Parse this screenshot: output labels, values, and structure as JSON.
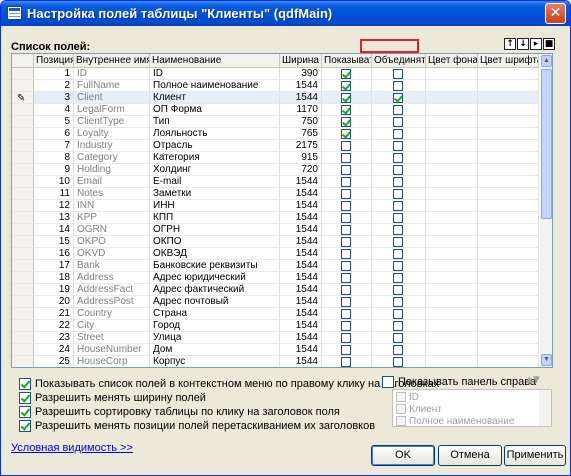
{
  "window": {
    "title": "Настройка полей таблицы \"Клиенты\" (qdfMain)",
    "close": "✕"
  },
  "section_label": "Список полей:",
  "toolbar": {
    "up": "↑",
    "down": "↓",
    "btn3": "▸",
    "btn4": "■"
  },
  "columns": [
    "Позиция",
    "Внутреннее имя",
    "Наименование",
    "Ширина",
    "Показывать",
    "Объединять",
    "Цвет фона",
    "Цвет шрифта"
  ],
  "rows": [
    {
      "pos": "1",
      "name": "ID",
      "title": "ID",
      "width": "390",
      "show": true,
      "merge": false
    },
    {
      "pos": "2",
      "name": "FullName",
      "title": "Полное наименование",
      "width": "1544",
      "show": true,
      "merge": false
    },
    {
      "pos": "3",
      "name": "Client",
      "title": "Клиент",
      "width": "1544",
      "show": true,
      "merge": true,
      "selected": true
    },
    {
      "pos": "4",
      "name": "LegalForm",
      "title": "ОП Форма",
      "width": "1170",
      "show": true,
      "merge": false
    },
    {
      "pos": "5",
      "name": "ClientType",
      "title": "Тип",
      "width": "750",
      "show": true,
      "merge": false
    },
    {
      "pos": "6",
      "name": "Loyalty",
      "title": "Лояльность",
      "width": "765",
      "show": true,
      "merge": false
    },
    {
      "pos": "7",
      "name": "Industry",
      "title": "Отрасль",
      "width": "2175",
      "show": false,
      "merge": false
    },
    {
      "pos": "8",
      "name": "Category",
      "title": "Категория",
      "width": "915",
      "show": false,
      "merge": false
    },
    {
      "pos": "9",
      "name": "Holding",
      "title": "Холдинг",
      "width": "720",
      "show": false,
      "merge": false
    },
    {
      "pos": "10",
      "name": "Email",
      "title": "E-mail",
      "width": "1544",
      "show": false,
      "merge": false
    },
    {
      "pos": "11",
      "name": "Notes",
      "title": "Заметки",
      "width": "1544",
      "show": false,
      "merge": false
    },
    {
      "pos": "12",
      "name": "INN",
      "title": "ИНН",
      "width": "1544",
      "show": false,
      "merge": false
    },
    {
      "pos": "13",
      "name": "KPP",
      "title": "КПП",
      "width": "1544",
      "show": false,
      "merge": false
    },
    {
      "pos": "14",
      "name": "OGRN",
      "title": "ОГРН",
      "width": "1544",
      "show": false,
      "merge": false
    },
    {
      "pos": "15",
      "name": "OKPO",
      "title": "ОКПО",
      "width": "1544",
      "show": false,
      "merge": false
    },
    {
      "pos": "16",
      "name": "OKVD",
      "title": "ОКВЭД",
      "width": "1544",
      "show": false,
      "merge": false
    },
    {
      "pos": "17",
      "name": "Bank",
      "title": "Банковские реквизиты",
      "width": "1544",
      "show": false,
      "merge": false
    },
    {
      "pos": "18",
      "name": "Address",
      "title": "Адрес юридический",
      "width": "1544",
      "show": false,
      "merge": false
    },
    {
      "pos": "19",
      "name": "AddressFact",
      "title": "Адрес фактический",
      "width": "1544",
      "show": false,
      "merge": false
    },
    {
      "pos": "20",
      "name": "AddressPost",
      "title": "Адрес почтовый",
      "width": "1544",
      "show": false,
      "merge": false
    },
    {
      "pos": "21",
      "name": "Country",
      "title": "Страна",
      "width": "1544",
      "show": false,
      "merge": false
    },
    {
      "pos": "22",
      "name": "City",
      "title": "Город",
      "width": "1544",
      "show": false,
      "merge": false
    },
    {
      "pos": "23",
      "name": "Street",
      "title": "Улица",
      "width": "1544",
      "show": false,
      "merge": false
    },
    {
      "pos": "24",
      "name": "HouseNumber",
      "title": "Дом",
      "width": "1544",
      "show": false,
      "merge": false
    },
    {
      "pos": "25",
      "name": "HouseCorp",
      "title": "Корпус",
      "width": "1544",
      "show": false,
      "merge": false
    }
  ],
  "options": [
    {
      "label": "Показывать список полей в контекстном меню по правому клику на заголовках",
      "checked": true
    },
    {
      "label": "Разрешить менять ширину полей",
      "checked": true
    },
    {
      "label": "Разрешить сортировку таблицы по клику на заголовок поля",
      "checked": true
    },
    {
      "label": "Разрешить менять позиции полей перетаскиванием их заголовков",
      "checked": true
    }
  ],
  "right_panel": {
    "label": "Показывать панель справа",
    "checked": false,
    "items": [
      "ID",
      "Клиент",
      "Полное наименование"
    ]
  },
  "link": "Условная видимость >>",
  "buttons": {
    "ok": "OK",
    "cancel": "Отмена",
    "apply": "Применить"
  },
  "colors": {
    "title_bar": "#0250d6",
    "dialog_bg": "#ece9d8",
    "check_mark": "#21a121",
    "highlight": "#e0202a",
    "link": "#0000ee"
  }
}
